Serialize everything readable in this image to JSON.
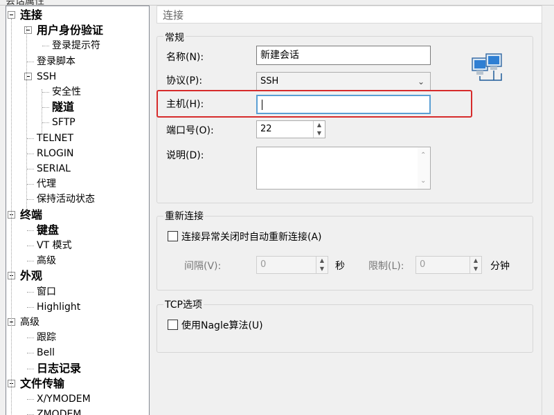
{
  "window": {
    "partial_title": "会话属性"
  },
  "tree": {
    "items": [
      {
        "label": "连接",
        "depth": 0,
        "bold": true
      },
      {
        "label": "用户身份验证",
        "depth": 1,
        "bold": true
      },
      {
        "label": "登录提示符",
        "depth": 2,
        "bold": false
      },
      {
        "label": "登录脚本",
        "depth": 1,
        "bold": false
      },
      {
        "label": "SSH",
        "depth": 1,
        "bold": false
      },
      {
        "label": "安全性",
        "depth": 2,
        "bold": false
      },
      {
        "label": "隧道",
        "depth": 2,
        "bold": true
      },
      {
        "label": "SFTP",
        "depth": 2,
        "bold": false
      },
      {
        "label": "TELNET",
        "depth": 1,
        "bold": false
      },
      {
        "label": "RLOGIN",
        "depth": 1,
        "bold": false
      },
      {
        "label": "SERIAL",
        "depth": 1,
        "bold": false
      },
      {
        "label": "代理",
        "depth": 1,
        "bold": false
      },
      {
        "label": "保持活动状态",
        "depth": 1,
        "bold": false
      },
      {
        "label": "终端",
        "depth": 0,
        "bold": true
      },
      {
        "label": "键盘",
        "depth": 1,
        "bold": true
      },
      {
        "label": "VT 模式",
        "depth": 1,
        "bold": false
      },
      {
        "label": "高级",
        "depth": 1,
        "bold": false
      },
      {
        "label": "外观",
        "depth": 0,
        "bold": true
      },
      {
        "label": "窗口",
        "depth": 1,
        "bold": false
      },
      {
        "label": "Highlight",
        "depth": 1,
        "bold": false
      },
      {
        "label": "高级",
        "depth": 0,
        "bold": false
      },
      {
        "label": "跟踪",
        "depth": 1,
        "bold": false
      },
      {
        "label": "Bell",
        "depth": 1,
        "bold": false
      },
      {
        "label": "日志记录",
        "depth": 1,
        "bold": true
      },
      {
        "label": "文件传输",
        "depth": 0,
        "bold": true
      },
      {
        "label": "X/YMODEM",
        "depth": 1,
        "bold": false
      },
      {
        "label": "ZMODEM",
        "depth": 1,
        "bold": false
      }
    ]
  },
  "pane": {
    "title": "连接",
    "general": {
      "group_label": "常规",
      "name_label": "名称(N):",
      "name_value": "新建会话",
      "protocol_label": "协议(P):",
      "protocol_value": "SSH",
      "host_label": "主机(H):",
      "host_value": "",
      "port_label": "端口号(O):",
      "port_value": "22",
      "desc_label": "说明(D):",
      "desc_value": ""
    },
    "reconnect": {
      "group_label": "重新连接",
      "checkbox_label": "连接异常关闭时自动重新连接(A)",
      "checked": false,
      "interval_label": "间隔(V):",
      "interval_value": "0",
      "interval_unit": "秒",
      "limit_label": "限制(L):",
      "limit_value": "0",
      "limit_unit": "分钟"
    },
    "tcp": {
      "group_label": "TCP选项",
      "nagle_label": "使用Nagle算法(U)",
      "nagle_checked": false
    }
  },
  "colors": {
    "highlight": "#d62b2b",
    "focus_border": "#5a9fd4"
  },
  "icons": {
    "network": "network-computers-icon",
    "expander": "tree-collapse-icon",
    "dropdown": "chevron-down-icon",
    "spin_up": "spin-up-icon",
    "spin_down": "spin-down-icon"
  }
}
